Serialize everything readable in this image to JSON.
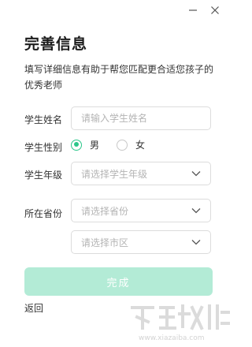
{
  "window": {
    "minimize_icon": "minimize-icon",
    "close_icon": "close-icon"
  },
  "form": {
    "title": "完善信息",
    "subtitle": "填写详细信息有助于帮您匹配更合适您孩子的优秀老师",
    "name": {
      "label": "学生姓名",
      "placeholder": "请输入学生姓名",
      "value": ""
    },
    "gender": {
      "label": "学生性别",
      "options": [
        {
          "label": "男",
          "selected": true
        },
        {
          "label": "女",
          "selected": false
        }
      ]
    },
    "grade": {
      "label": "学生年级",
      "placeholder": "请选择学生年级"
    },
    "region": {
      "label": "所在省份",
      "province_placeholder": "请选择省份",
      "city_placeholder": "请选择市区"
    },
    "submit_label": "完成",
    "back_label": "返回"
  },
  "watermark": {
    "text": "www.xiazaiba.com"
  },
  "colors": {
    "accent": "#2bc68a",
    "button_disabled": "#b3ebd6",
    "border": "#dcdcdc",
    "placeholder": "#b4b4b4"
  }
}
